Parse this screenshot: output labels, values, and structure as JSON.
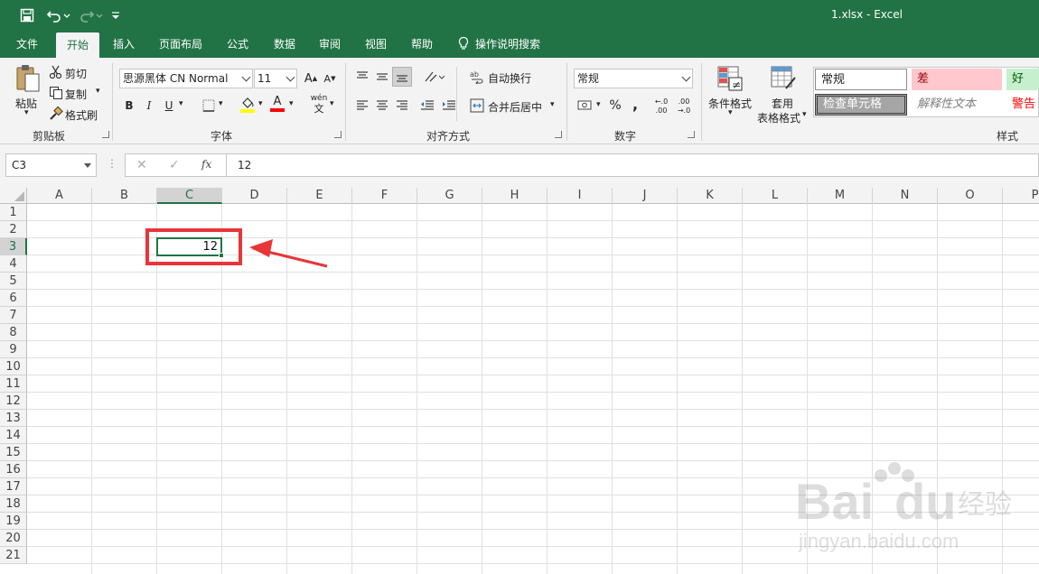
{
  "titlebar": {
    "title": "1.xlsx  -  Excel",
    "qa_dropdown": "▾"
  },
  "menu": {
    "tabs": [
      {
        "label": "文件",
        "active": false
      },
      {
        "label": "开始",
        "active": true
      },
      {
        "label": "插入",
        "active": false
      },
      {
        "label": "页面布局",
        "active": false
      },
      {
        "label": "公式",
        "active": false
      },
      {
        "label": "数据",
        "active": false
      },
      {
        "label": "审阅",
        "active": false
      },
      {
        "label": "视图",
        "active": false
      },
      {
        "label": "帮助",
        "active": false
      }
    ],
    "tell_me": "操作说明搜索"
  },
  "ribbon": {
    "clipboard": {
      "label": "剪贴板",
      "paste": "粘贴",
      "cut": "剪切",
      "copy": "复制",
      "format_painter": "格式刷"
    },
    "font": {
      "label": "字体",
      "font_name": "思源黑体 CN Normal",
      "font_size": "11",
      "bold": "B",
      "italic": "I",
      "underline": "U",
      "grow": "A",
      "shrink": "A",
      "phonetic_top": "wén",
      "phonetic_bottom": "文",
      "font_color": "A"
    },
    "alignment": {
      "label": "对齐方式",
      "wrap_text": "自动换行",
      "merge_center": "合并后居中"
    },
    "number": {
      "label": "数字",
      "format": "常规",
      "percent": "%",
      "comma": ",",
      "inc_decimal_top": "←.0",
      "inc_decimal_bottom": ".00",
      "dec_decimal_top": ".00",
      "dec_decimal_bottom": "→.0"
    },
    "styles": {
      "label": "样式",
      "conditional_formatting": "条件格式",
      "format_as_table_1": "套用",
      "format_as_table_2": "表格格式",
      "normal": "常规",
      "bad": "差",
      "good": "好",
      "check_cell": "检查单元格",
      "explanatory": "解释性文本",
      "warning": "警告"
    }
  },
  "formulabar": {
    "name_box": "C3",
    "cancel": "✕",
    "enter": "✓",
    "fx": "fx",
    "formula": "12"
  },
  "sheet": {
    "columns": [
      "A",
      "B",
      "C",
      "D",
      "E",
      "F",
      "G",
      "H",
      "I",
      "J",
      "K",
      "L",
      "M",
      "N",
      "O",
      "P"
    ],
    "selected_column": "C",
    "rows": [
      "1",
      "2",
      "3",
      "4",
      "5",
      "6",
      "7",
      "8",
      "9",
      "10",
      "11",
      "12",
      "13",
      "14",
      "15",
      "16",
      "17",
      "18",
      "19",
      "20",
      "21"
    ],
    "selected_row": "3",
    "active_cell_value": "12"
  },
  "colors": {
    "excel_green": "#217346",
    "annotation_red": "#e8353a",
    "bad_fill": "#ffc7ce",
    "bad_text": "#9c0006",
    "good_fill": "#c6efce",
    "good_text": "#006100"
  },
  "watermark": {
    "brand": "Bai",
    "brand2": "du",
    "product": "经验",
    "url": "jingyan.baidu.com"
  }
}
